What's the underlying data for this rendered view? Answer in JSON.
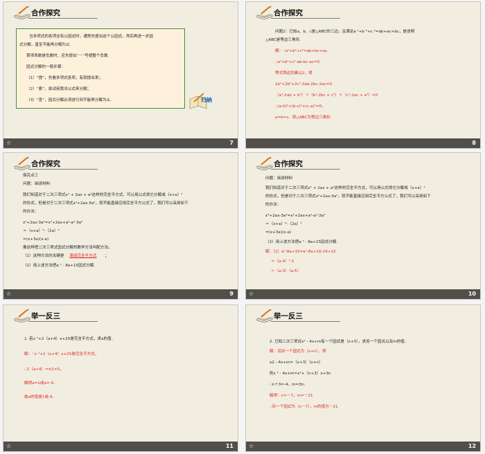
{
  "slides": [
    {
      "number": "7",
      "title": "合作探究",
      "lines": [
        "当多项式的各项含有公因式时，通常先提出这个公因式，然后再进一步因",
        "式分解，直至不能再分解为止.",
        "首项系数是负数时，应先提出“－”号使整个负数.",
        "因式分解的一般步骤：",
        "（1）“提”，先看多项式各项，有就提出来；",
        "（2）“套”，尝试用我法公式来分解；",
        "（3）“查”，因式分解必须进行到不能再分解为止."
      ],
      "summary_label": "归纳"
    },
    {
      "number": "8",
      "title": "合作探究",
      "lines": [
        "问题2：已知a、b、c是△ABC的三边，且满足a ²+b ²+c ²=ab+ac+bc，是说明",
        "△ABC是等边三角形.",
        "解：∵a²+b²+c²=ab+bc+ac,",
        "∴a²+b²+c²-ab-bc-ac=0",
        "等式两边同乘以2，得",
        "2a²+2b²+2c²-2ab-2bc-2ac=0",
        "（a²-2ab + b²）＋（b²-2bc + c²）＋（c²-2ac + a²）=0",
        "∴(a-b)²+(b-c)²+(c-a)²=0，",
        "a=b=c，即△ABC为等边三角形"
      ]
    },
    {
      "number": "9",
      "title": "合作探究",
      "lines": [
        "探究点三",
        "问题：阅读材料",
        "我们知道对于二次三项式x² + 2ax + a²这样的完全平方式，可以用公式将它分解成（x+a）²",
        "的形式，但是对于二次三项式x²+2ax-3a²，就不能直接应用完全平方公式了，我们可以采用如下",
        "的办法：",
        "x²+2ax-3a²=x²+2ax+a²-a²-3a²",
        "＝（x+a）²-（2a）²",
        "=(x+3a)(x-a)",
        "像这样把二次三项式因式分解的数学方法叫配方法。",
        "（1）这种方法的关键是",
        "（2）用上述方法把a ² - 8a+15因式分解."
      ],
      "blank_answer": "凑成完全平方式",
      "blank_after": "；"
    },
    {
      "number": "10",
      "title": "合作探究",
      "lines": [
        "问题：阅读材料",
        "我们知道对于二次三项式x² + 2ax + a²这样的完全平方式，可以用公式将它分解成（x+a）²",
        "的形式，但是对于二次三项式x²+2ax-3a²，就不能直接应用完全平方公式了，我们可以采用如下",
        "的办法：",
        "x²+2ax-3a²=x²+2ax+a²-a²-3a²",
        "＝（x+a）²-（2a）²",
        "=(x+3a)(x-a)",
        "（2）用上述方法把a ² - 8a+15因式分解.",
        "解：（2）a²-8a+15=a²-8a+16-16+15",
        "＝（a-4）²-1",
        "＝（a-3）（a-5）"
      ]
    },
    {
      "number": "11",
      "title": "举一反三",
      "lines": [
        "1. 若x ²+2（a+4）x+25是完全平方式，求a的值．",
        "解：∵x ²+2（a+4）x+25是完全平方式，",
        "∴2（a+4）=±2×5，",
        "解得a=1或a=-9．",
        "故a的值是1或-9．"
      ]
    },
    {
      "number": "12",
      "title": "举一反三",
      "lines": [
        "2. 已知二次三项式x² - 4x+m有一个因式是（x+3），求另一个因式以及m的值．",
        "解：设另一个因式为（x+n），得",
        "x2 - 4x+m=（x+3）（x+n）",
        "则x ² - 4x+m=x²+（n+3）x+3n",
        "∴n＋3=-4，m=3n．",
        "解得：n=－7，m=－21",
        "∴另一个因式为（x－7），m的值为－21."
      ]
    }
  ],
  "colors": {
    "slide_bg": "#f1eee1",
    "footer": "#514f4a",
    "answer_red": "#e0241e",
    "box_border": "#4b8a36",
    "box_fill": "#fdf1dc"
  },
  "icons": [
    "book-pen-icon",
    "star-footer-icon",
    "summary-book-icon"
  ],
  "footer_glyph": "☆"
}
